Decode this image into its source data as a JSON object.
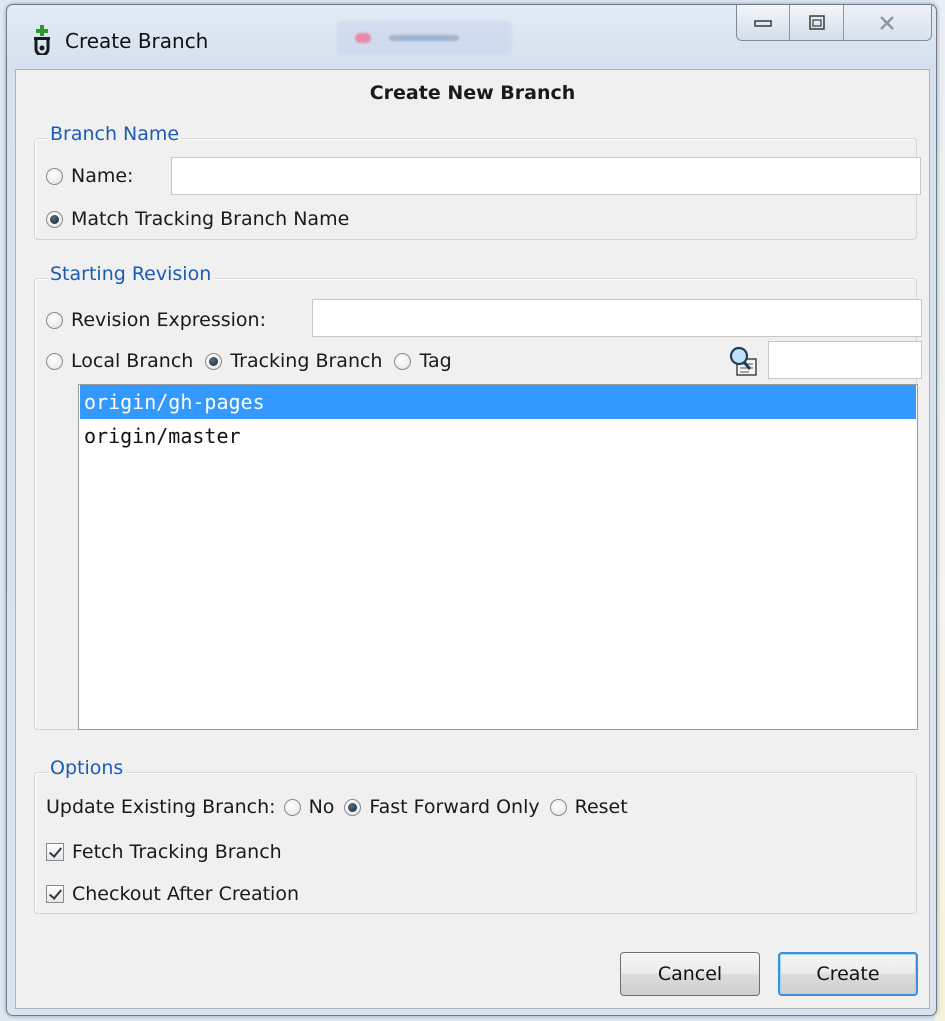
{
  "window": {
    "title": "Create Branch",
    "colors": {
      "accent": "#1b5ab7",
      "selection": "#3399ff"
    },
    "icons": {
      "app": "git-branch-add-icon",
      "minimize": "minimize-icon",
      "maximize": "maximize-icon",
      "close": "close-icon"
    }
  },
  "dialog": {
    "heading": "Create New Branch",
    "branch_name": {
      "legend": "Branch Name",
      "name_label": "Name:",
      "name_value": "",
      "match_label": "Match Tracking Branch Name",
      "selected": "match"
    },
    "starting_revision": {
      "legend": "Starting Revision",
      "expression_label": "Revision Expression:",
      "expression_value": "",
      "local_label": "Local Branch",
      "tracking_label": "Tracking Branch",
      "tag_label": "Tag",
      "selected": "tracking",
      "filter_value": "",
      "filter_icon": "search-icon",
      "branches": [
        "origin/gh-pages",
        "origin/master"
      ],
      "selected_branch": "origin/gh-pages"
    },
    "options": {
      "legend": "Options",
      "update_label": "Update Existing Branch:",
      "no_label": "No",
      "ff_label": "Fast Forward Only",
      "reset_label": "Reset",
      "update_selected": "fast-forward-only",
      "fetch_label": "Fetch Tracking Branch",
      "fetch_checked": true,
      "checkout_label": "Checkout After Creation",
      "checkout_checked": true
    },
    "buttons": {
      "cancel": "Cancel",
      "create": "Create"
    }
  }
}
